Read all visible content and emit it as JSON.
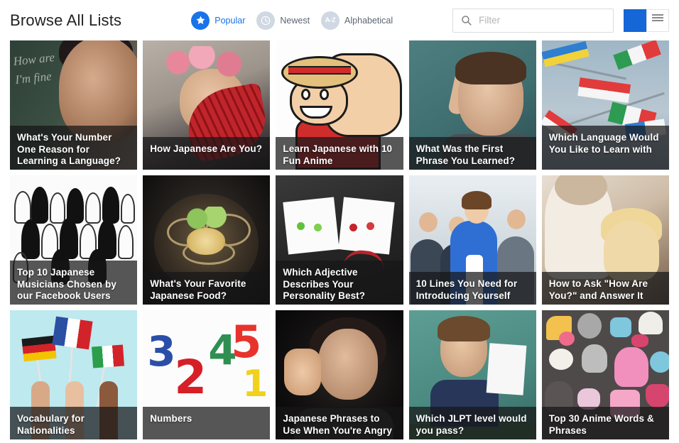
{
  "header": {
    "title": "Browse All Lists",
    "sorts": [
      {
        "label": "Popular",
        "icon": "star-icon",
        "active": true
      },
      {
        "label": "Newest",
        "icon": "clock-icon",
        "active": false
      },
      {
        "label": "Alphabetical",
        "icon": "a-z-icon",
        "active": false,
        "icon_text": "A-Z"
      }
    ],
    "filter": {
      "placeholder": "Filter",
      "value": "",
      "icon": "search-icon"
    },
    "views": [
      {
        "name": "grid-view",
        "icon": "grid-icon",
        "active": true
      },
      {
        "name": "list-view",
        "icon": "list-icon",
        "active": false
      }
    ]
  },
  "colors": {
    "accent": "#1a73e8",
    "accent_button": "#1566d6",
    "inactive_icon": "#cfd8e3",
    "title_text": "#222222",
    "caption_overlay": "rgba(22,22,24,0.72)"
  },
  "cards": [
    {
      "title": "What's Your Number One Reason for Learning a Language?",
      "thumb": "chalkboard-teacher"
    },
    {
      "title": "How Japanese Are You?",
      "thumb": "girl-with-fan"
    },
    {
      "title": "Learn Japanese with 10 Fun Anime",
      "thumb": "anime-character"
    },
    {
      "title": "What Was the First Phrase You Learned?",
      "thumb": "man-at-chalkboard"
    },
    {
      "title": "Which Language Would You Like to Learn with",
      "thumb": "flags-in-sky"
    },
    {
      "title": "Top 10 Japanese Musicians Chosen by our Facebook Users",
      "thumb": "crowd-line-art"
    },
    {
      "title": "What's Your Favorite Japanese Food?",
      "thumb": "noodle-bowl"
    },
    {
      "title": "Which Adjective Describes Your Personality Best?",
      "thumb": "paper-faces"
    },
    {
      "title": "10 Lines You Need for Introducing Yourself",
      "thumb": "business-people"
    },
    {
      "title": "How to Ask \"How Are You?\" and Answer It",
      "thumb": "two-women-cafe"
    },
    {
      "title": "Vocabulary for Nationalities",
      "thumb": "hands-with-flags"
    },
    {
      "title": "Numbers",
      "thumb": "colorful-numbers"
    },
    {
      "title": "Japanese Phrases to Use When You're Angry",
      "thumb": "angry-woman"
    },
    {
      "title": "Which JLPT level would you pass?",
      "thumb": "man-with-paper"
    },
    {
      "title": "Top 30 Anime Words & Phrases",
      "thumb": "kawaii-pattern"
    }
  ]
}
